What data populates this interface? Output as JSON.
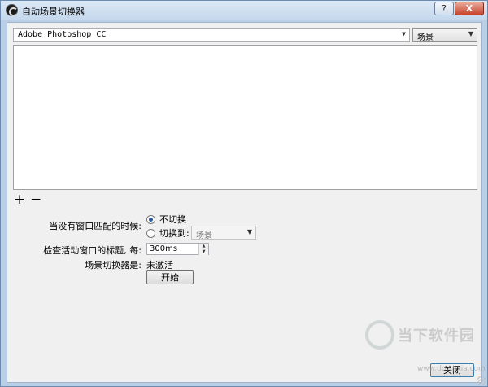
{
  "window": {
    "title": "自动场景切换器",
    "help_label": "?",
    "close_label": "X"
  },
  "top": {
    "application": "Adobe Photoshop CC",
    "scene": "场景"
  },
  "list": {
    "items": []
  },
  "list_buttons": {
    "add_label": "+",
    "remove_label": "−"
  },
  "settings": {
    "no_match_label": "当没有窗口匹配的时候:",
    "option_dont_switch": "不切换",
    "option_switch_to": "切换到:",
    "switch_to_scene": "场景",
    "check_label": "检查活动窗口的标题, 每:",
    "interval": "300ms",
    "status_label": "场景切换器是:",
    "status_value": "未激活",
    "start_label": "开始"
  },
  "footer": {
    "close_label": "关闭"
  },
  "watermark": {
    "text": "当下软件园",
    "url": "www.downxia.com"
  },
  "icons": {
    "dropdown": "chevron-down-icon",
    "spin_up": "spin-up-icon",
    "spin_down": "spin-down-icon"
  },
  "colors": {
    "accent": "#2a5b9c",
    "titlebar": "#c4d7ec",
    "close": "#c7432a"
  }
}
